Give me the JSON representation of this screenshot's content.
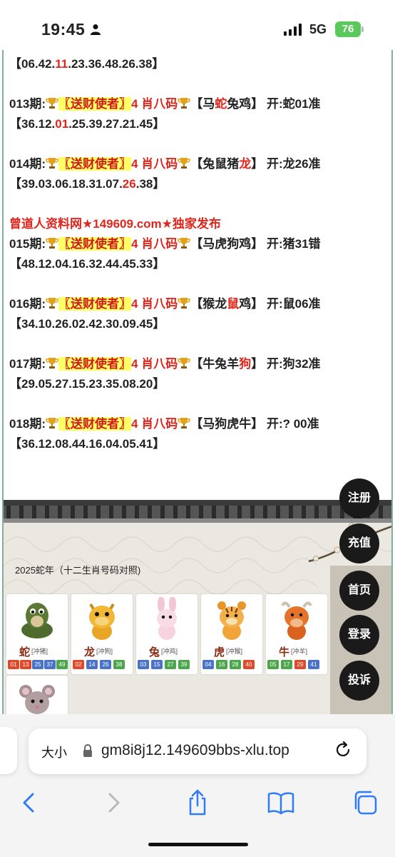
{
  "status": {
    "time": "19:45",
    "network": "5G",
    "battery": "76"
  },
  "posts": {
    "top_numbers": {
      "open": "【",
      "a": "06.42.",
      "hit": "11",
      "b": ".23.36.48.26.38】"
    },
    "p013": {
      "period": "013期:",
      "brand": "〖送财使者〗",
      "title": "4 肖八码",
      "z_open": "【马",
      "z_hit": "蛇",
      "z_rest": "兔鸡】",
      "result": "开:蛇01准",
      "n_a": "【36.12.",
      "n_hit": "01",
      "n_b": ".25.39.27.21.45】"
    },
    "p014": {
      "period": "014期:",
      "brand": "〖送财使者〗",
      "title": "4 肖八码",
      "z_open": "【兔鼠猪",
      "z_hit": "龙",
      "z_rest": "】",
      "result": "开:龙26准",
      "n_a": "【39.03.06.18.31.07.",
      "n_hit": "26",
      "n_b": ".38】"
    },
    "promo": "曾道人资料网★149609.com★独家发布",
    "p015": {
      "period": "015期:",
      "brand": "〖送财使者〗",
      "title": "4 肖八码",
      "zodiac": "【马虎狗鸡】",
      "result": "开:猪31错",
      "numbers": "【48.12.04.16.32.44.45.33】"
    },
    "p016": {
      "period": "016期:",
      "brand": "〖送财使者〗",
      "title": "4 肖八码",
      "z_open": "【猴龙",
      "z_hit": "鼠",
      "z_rest": "鸡】",
      "result": "开:鼠06准",
      "numbers": "【34.10.26.02.42.30.09.45】"
    },
    "p017": {
      "period": "017期:",
      "brand": "〖送财使者〗",
      "title": "4 肖八码",
      "z_open": "【牛兔羊",
      "z_hit": "狗",
      "z_rest": "】",
      "result": "开:狗32准",
      "numbers": "【29.05.27.15.23.35.08.20】"
    },
    "p018": {
      "period": "018期:",
      "brand": "〖送财使者〗",
      "title": "4 肖八码",
      "zodiac": "【马狗虎牛】",
      "result": "开:? 00准",
      "numbers": "【36.12.08.44.16.04.05.41】"
    }
  },
  "zodiac_section": {
    "title": "2025蛇年（十二生肖号码对照)",
    "cards": [
      {
        "name": "蛇",
        "chong": "[冲猪]",
        "nums": [
          "01",
          "13",
          "25",
          "37",
          "49"
        ],
        "colors": [
          "red",
          "red",
          "blue",
          "blue",
          "green"
        ]
      },
      {
        "name": "龙",
        "chong": "[冲狗]",
        "nums": [
          "02",
          "14",
          "26",
          "38"
        ],
        "colors": [
          "red",
          "blue",
          "blue",
          "green"
        ]
      },
      {
        "name": "兔",
        "chong": "[冲鸡]",
        "nums": [
          "03",
          "15",
          "27",
          "39"
        ],
        "colors": [
          "blue",
          "blue",
          "green",
          "green"
        ]
      },
      {
        "name": "虎",
        "chong": "[冲猴]",
        "nums": [
          "04",
          "16",
          "28",
          "40"
        ],
        "colors": [
          "blue",
          "green",
          "green",
          "red"
        ]
      },
      {
        "name": "牛",
        "chong": "[冲羊]",
        "nums": [
          "05",
          "17",
          "29",
          "41"
        ],
        "colors": [
          "green",
          "green",
          "red",
          "blue"
        ]
      }
    ]
  },
  "float_buttons": [
    "注册",
    "充值",
    "首页",
    "登录",
    "投诉"
  ],
  "browser": {
    "text_size_label": "大小",
    "url": "gm8i8j12.149609bbs-xlu.top"
  },
  "colors": {
    "red": "#e0261c",
    "highlight": "#ffff66",
    "border": "#7fb0a0",
    "ios_blue": "#2f7cf6"
  }
}
